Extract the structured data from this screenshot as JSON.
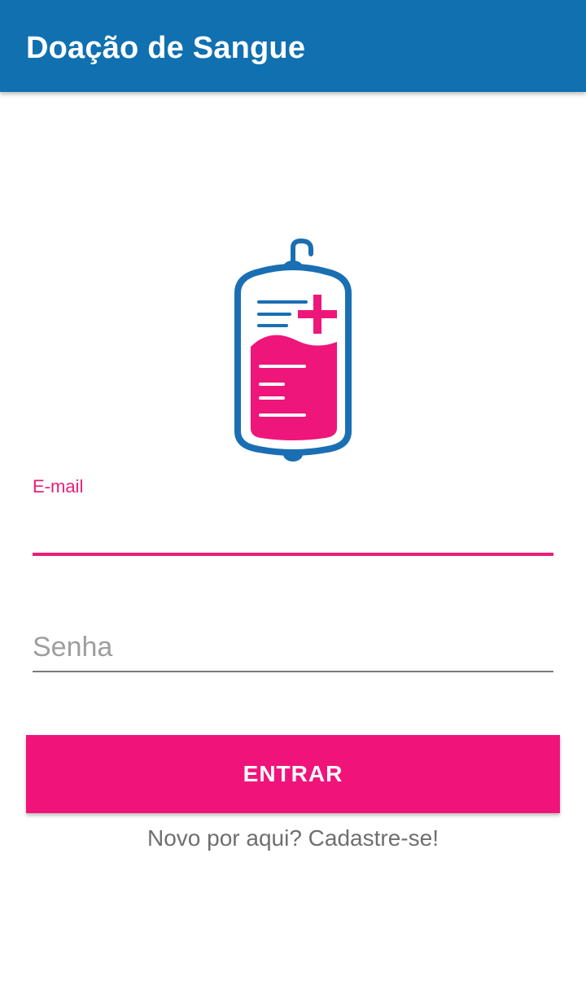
{
  "app_bar": {
    "title": "Doação de Sangue"
  },
  "logo": {
    "icon": "blood-bag-icon",
    "colors": {
      "outline": "#1a6fb3",
      "blood": "#ee167a"
    }
  },
  "form": {
    "email": {
      "label": "E-mail",
      "value": "",
      "focused": true
    },
    "password": {
      "placeholder": "Senha",
      "value": ""
    },
    "submit_label": "ENTRAR",
    "signup_text": "Novo por aqui? Cadastre-se!"
  },
  "colors": {
    "primary": "#1070b0",
    "accent": "#f0147a",
    "hint": "#9e9e9e",
    "secondary_text": "#6f6f6f"
  }
}
